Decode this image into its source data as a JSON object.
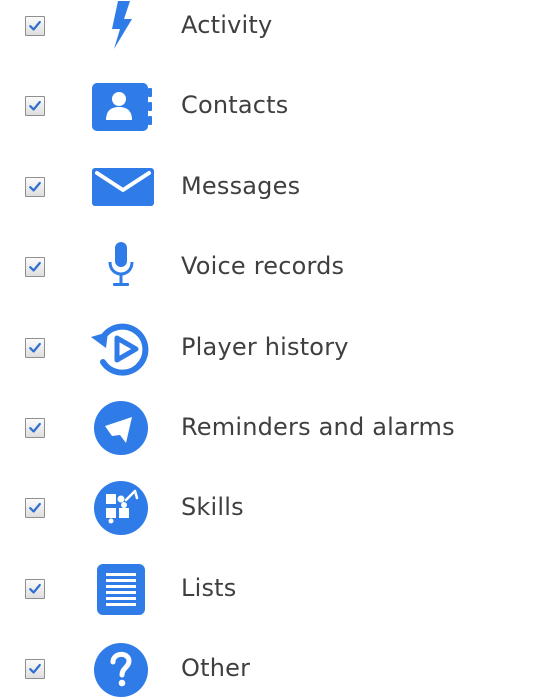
{
  "colors": {
    "icon_blue": "#2f7ce8",
    "label_text": "#3f3f3f",
    "checkbox_border": "#8f8f8f",
    "checkmark": "#2f6fd1"
  },
  "items": [
    {
      "label": "Activity",
      "checked": true,
      "icon": "lightning-bolt-icon"
    },
    {
      "label": "Contacts",
      "checked": true,
      "icon": "contacts-book-icon"
    },
    {
      "label": "Messages",
      "checked": true,
      "icon": "envelope-icon"
    },
    {
      "label": "Voice records",
      "checked": true,
      "icon": "microphone-icon"
    },
    {
      "label": "Player history",
      "checked": true,
      "icon": "player-history-icon"
    },
    {
      "label": "Reminders and alarms",
      "checked": true,
      "icon": "reminder-bell-icon"
    },
    {
      "label": "Skills",
      "checked": true,
      "icon": "skills-puzzle-icon"
    },
    {
      "label": "Lists",
      "checked": true,
      "icon": "list-document-icon"
    },
    {
      "label": "Other",
      "checked": true,
      "icon": "question-mark-icon"
    }
  ]
}
